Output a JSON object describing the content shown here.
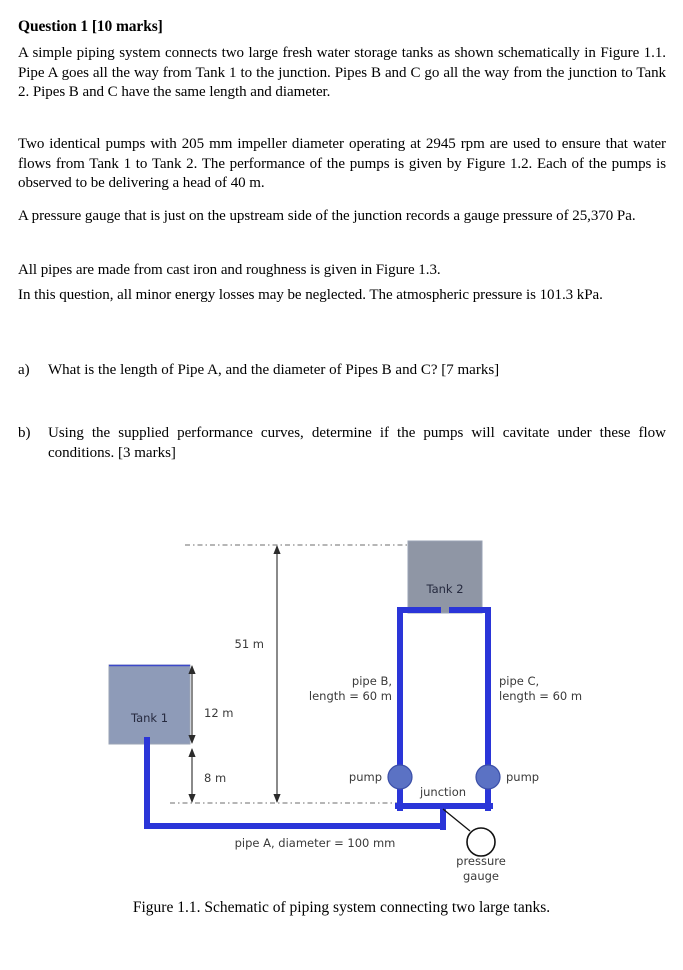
{
  "question": {
    "title": "Question 1 [10 marks]",
    "paragraphs": [
      "A simple piping system connects two large fresh water storage tanks as shown schematically in Figure 1.1. Pipe A goes all the way from Tank 1 to the junction. Pipes B and C go all the way from the junction to Tank 2. Pipes B and C have the same length and diameter.",
      "Two identical pumps with 205 mm impeller diameter operating at 2945 rpm are used to ensure that water flows from Tank 1 to Tank 2. The performance of the pumps is given by Figure 1.2. Each of the pumps is observed to be delivering a head of 40 m.",
      "A pressure gauge that is just on the upstream side of the junction records a gauge pressure of 25,370 Pa.",
      "All pipes are made from cast iron and roughness is given in Figure 1.3.",
      "In this question, all minor energy losses may be neglected. The atmospheric pressure is 101.3 kPa."
    ],
    "items": [
      {
        "marker": "a)",
        "text": "What is the length of Pipe A, and the diameter of Pipes B and C? [7 marks]"
      },
      {
        "marker": "b)",
        "text": "Using the supplied performance curves, determine if the pumps will cavitate under these flow conditions. [3 marks]"
      }
    ]
  },
  "figure": {
    "caption": "Figure 1.1. Schematic of piping system connecting two large tanks.",
    "labels": {
      "tank1": "Tank 1",
      "tank2": "Tank 2",
      "height_51": "51 m",
      "height_12": "12 m",
      "height_8": "8 m",
      "pipe_b_line1": "pipe B,",
      "pipe_b_line2": "length = 60 m",
      "pipe_c_line1": "pipe C,",
      "pipe_c_line2": "length = 60 m",
      "pipe_a": "pipe A, diameter = 100 mm",
      "pump_left": "pump",
      "pump_right": "pump",
      "junction": "junction",
      "gauge_line1": "pressure",
      "gauge_line2": "gauge"
    },
    "colors": {
      "pipe": "#2a35d8",
      "pump_fill": "#5b72c4",
      "pump_stroke": "#3b4fa8",
      "tank1_fill": "#8e9bb8",
      "tank2_fill": "#8f96a5",
      "tank_stroke": "#9aa3b5",
      "datum": "#6d6d6d",
      "dimension": "#2b2b2b",
      "gauge_stroke": "#111111"
    }
  }
}
